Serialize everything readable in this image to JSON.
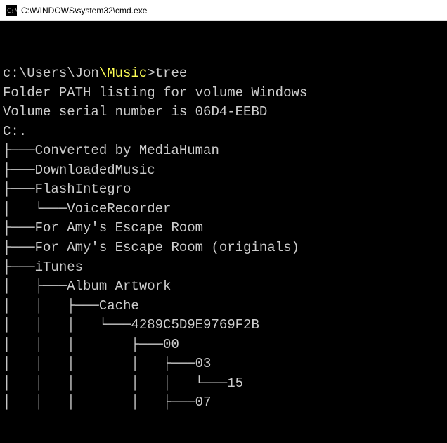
{
  "titlebar": {
    "icon": "cmd-icon",
    "title": "C:\\WINDOWS\\system32\\cmd.exe"
  },
  "terminal": {
    "prompt_base": "c:\\Users\\Jon",
    "prompt_sub": "\\Music",
    "prompt_sep": ">",
    "command": "tree",
    "header1": "Folder PATH listing for volume Windows",
    "header2": "Volume serial number is 06D4-EEBD",
    "root": "C:.",
    "lines": [
      "├───Converted by MediaHuman",
      "├───DownloadedMusic",
      "├───FlashIntegro",
      "│   └───VoiceRecorder",
      "├───For Amy's Escape Room",
      "├───For Amy's Escape Room (originals)",
      "├───iTunes",
      "│   ├───Album Artwork",
      "│   │   ├───Cache",
      "│   │   │   └───4289C5D9E9769F2B",
      "│   │   │       ├───00",
      "│   │   │       │   ├───03",
      "│   │   │       │   │   └───15",
      "│   │   │       │   ├───07"
    ]
  }
}
